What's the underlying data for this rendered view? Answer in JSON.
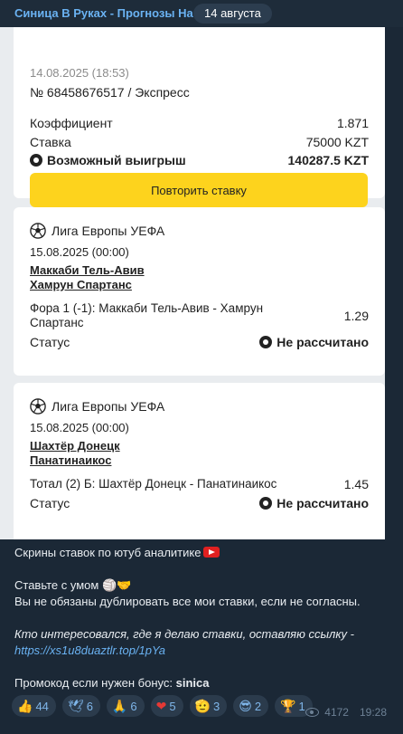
{
  "header": {
    "channel_title": "Синица В Руках - Прогнозы На",
    "date_pill": "14 августа"
  },
  "bet_slip": {
    "date": "14.08.2025 (18:53)",
    "number": "№ 68458676517 / Экспресс",
    "coef_label": "Коэффициент",
    "coef_value": "1.871",
    "stake_label": "Ставка",
    "stake_value": "75000 KZT",
    "win_label": "Возможный выигрыш",
    "win_value": "140287.5 KZT",
    "repeat_button": "Повторить ставку"
  },
  "events": [
    {
      "league": "Лига Европы УЕФА",
      "date": "15.08.2025 (00:00)",
      "team1": "Маккаби Тель-Авив",
      "team2": "Хамрун Спартанс",
      "market": "Фора 1 (-1): Маккаби Тель-Авив - Хамрун Спартанс",
      "odds": "1.29",
      "status_label": "Статус",
      "status_value": "Не рассчитано"
    },
    {
      "league": "Лига Европы УЕФА",
      "date": "15.08.2025 (00:00)",
      "team1": "Шахтёр Донецк",
      "team2": "Панатинаикос",
      "market": "Тотал (2) Б: Шахтёр Донецк - Панатинаикос",
      "odds": "1.45",
      "status_label": "Статус",
      "status_value": "Не рассчитано"
    }
  ],
  "message": {
    "line1": "Скрины ставок по ютуб аналитике",
    "line2": "Ставьте с умом",
    "line3": "Вы не обязаны дублировать все мои ставки, если не согласны.",
    "line4": "Кто интересовался, где я делаю ставки, оставляю ссылку -",
    "link": "https://xs1u8duaztlr.top/1pYa",
    "promo_prefix": "Промокод если нужен бонус:",
    "promo_code": "sinica"
  },
  "reactions": [
    {
      "emoji": "👍",
      "count": "44"
    },
    {
      "emoji": "🕊",
      "count": "6"
    },
    {
      "emoji": "🙏",
      "count": "6"
    },
    {
      "emoji": "❤",
      "count": "5"
    },
    {
      "emoji": "🫡",
      "count": "3"
    },
    {
      "emoji": "😎",
      "count": "2"
    },
    {
      "emoji": "🏆",
      "count": "1"
    }
  ],
  "meta": {
    "views": "4172",
    "time": "19:28"
  },
  "colors": {
    "background": "#1b2836",
    "accent_link": "#6ab2f2",
    "button_yellow": "#fdd31d"
  }
}
